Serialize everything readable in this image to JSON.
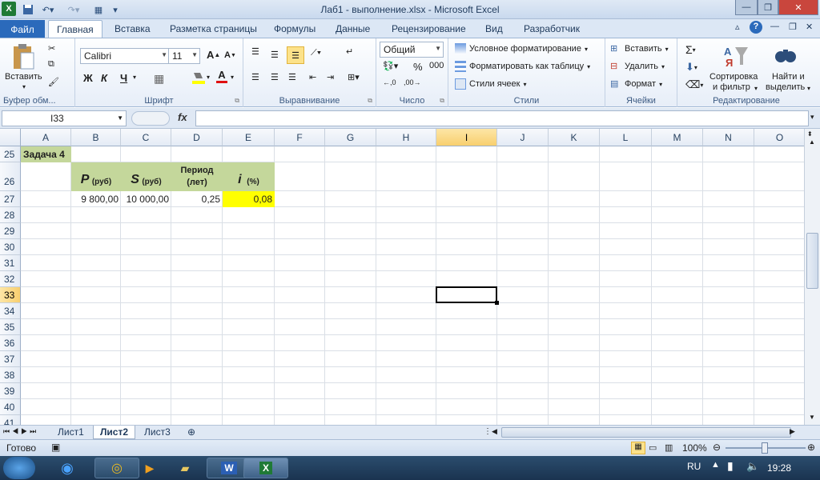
{
  "window": {
    "title": "Лаб1 - выполнение.xlsx - Microsoft Excel"
  },
  "tabs": {
    "file": "Файл",
    "items": [
      "Главная",
      "Вставка",
      "Разметка страницы",
      "Формулы",
      "Данные",
      "Рецензирование",
      "Вид",
      "Разработчик"
    ]
  },
  "ribbon": {
    "clipboard": {
      "paste": "Вставить",
      "label": "Буфер обм..."
    },
    "font": {
      "name": "Calibri",
      "size": "11",
      "bold": "Ж",
      "italic": "К",
      "underline": "Ч",
      "label": "Шрифт"
    },
    "alignment": {
      "label": "Выравнивание"
    },
    "number": {
      "format": "Общий",
      "percent": "%",
      "thousands": "000",
      "label": "Число"
    },
    "styles": {
      "conditional": "Условное форматирование",
      "as_table": "Форматировать как таблицу",
      "cell_styles": "Стили ячеек",
      "label": "Стили"
    },
    "cells": {
      "insert": "Вставить",
      "delete": "Удалить",
      "format": "Формат",
      "label": "Ячейки"
    },
    "editing": {
      "sort1": "Сортировка",
      "sort2": "и фильтр",
      "find1": "Найти и",
      "find2": "выделить",
      "label": "Редактирование"
    }
  },
  "formula_bar": {
    "name_box": "I33",
    "fx": "fx",
    "formula": ""
  },
  "grid": {
    "columns": [
      "A",
      "B",
      "C",
      "D",
      "E",
      "F",
      "G",
      "H",
      "I",
      "J",
      "K",
      "L",
      "M",
      "N",
      "O"
    ],
    "rows": [
      "25",
      "26",
      "27",
      "28",
      "29",
      "30",
      "31",
      "32",
      "33",
      "34",
      "35",
      "36",
      "37",
      "38",
      "39",
      "40",
      "41"
    ],
    "selected_col": "I",
    "selected_row": "33",
    "cells": {
      "A25": "Задача 4",
      "B26_var": "P",
      "B26_unit": "(руб)",
      "C26_var": "S",
      "C26_unit": "(руб)",
      "D26_l1": "Период",
      "D26_l2": "(лет)",
      "E26_var": "i",
      "E26_unit": "(%)",
      "B27": "9 800,00",
      "C27": "10 000,00",
      "D27": "0,25",
      "E27": "0,08"
    },
    "colors": {
      "green": "#c4d79b",
      "yellow": "#ffff00"
    }
  },
  "sheets": {
    "tabs": [
      "Лист1",
      "Лист2",
      "Лист3"
    ],
    "active": "Лист2"
  },
  "status": {
    "ready": "Готово",
    "zoom": "100%"
  },
  "taskbar": {
    "lang": "RU",
    "time": "19:28"
  }
}
